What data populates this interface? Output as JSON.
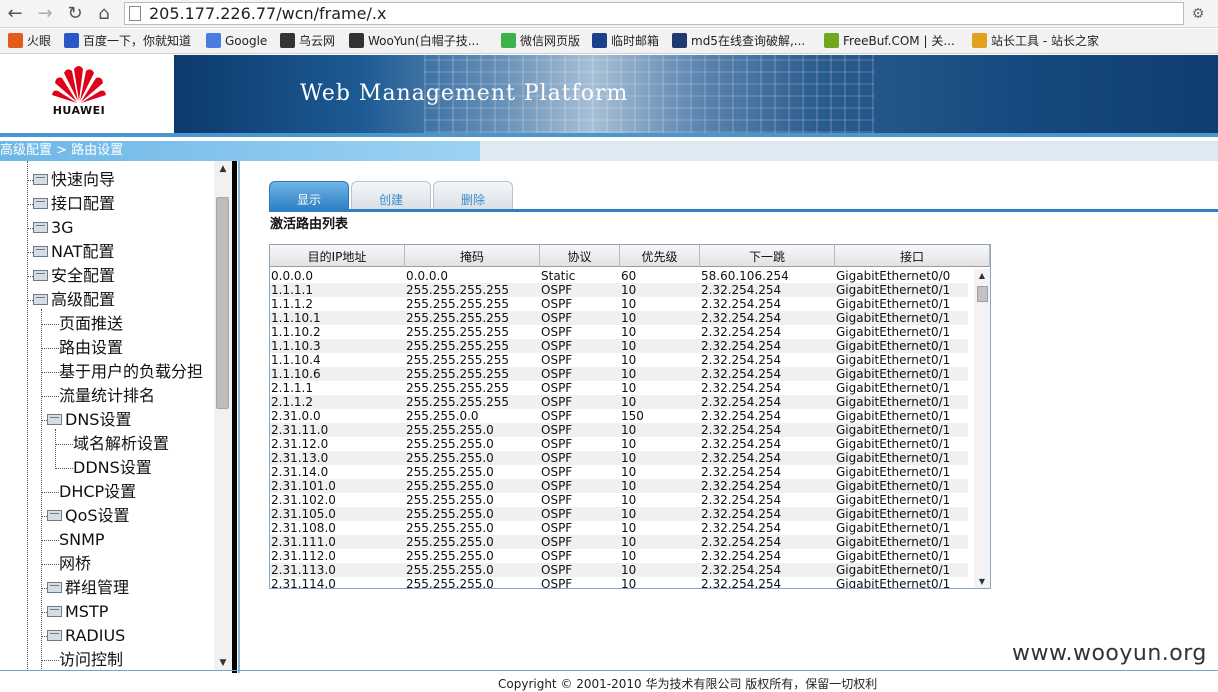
{
  "browser": {
    "url": "205.177.226.77/wcn/frame/.x",
    "back_icon": "arrow-left-icon",
    "forward_icon": "arrow-right-icon",
    "reload_icon": "reload-icon",
    "home_icon": "home-icon",
    "bookmarks": [
      {
        "label": "火眼",
        "color": "#e35b1c"
      },
      {
        "label": "百度一下，你就知道",
        "color": "#2a56c6"
      },
      {
        "label": "Google",
        "color": "#4a7be0"
      },
      {
        "label": "乌云网",
        "color": "#333333"
      },
      {
        "label": "WooYun(白帽子技...",
        "color": "#333333"
      },
      {
        "label": "微信网页版",
        "color": "#3bb24a"
      },
      {
        "label": "临时邮箱",
        "color": "#1c3f8c"
      },
      {
        "label": "md5在线查询破解,...",
        "color": "#1e3a6e"
      },
      {
        "label": "FreeBuf.COM | 关...",
        "color": "#6fa81c"
      },
      {
        "label": "站长工具 - 站长之家",
        "color": "#e0a11c"
      }
    ]
  },
  "header": {
    "logo_text": "HUAWEI",
    "title": "Web Management Platform",
    "brand_color": "#e1001a"
  },
  "breadcrumb": {
    "text": "高级配置 > 路由设置"
  },
  "sidebar": {
    "items": [
      {
        "label": "快速向导",
        "folder": true,
        "level": 0
      },
      {
        "label": "接口配置",
        "folder": true,
        "level": 0
      },
      {
        "label": "3G",
        "folder": true,
        "level": 0
      },
      {
        "label": "NAT配置",
        "folder": true,
        "level": 0
      },
      {
        "label": "安全配置",
        "folder": true,
        "level": 0
      },
      {
        "label": "高级配置",
        "folder": true,
        "level": 0
      },
      {
        "label": "页面推送",
        "folder": false,
        "level": 1
      },
      {
        "label": "路由设置",
        "folder": false,
        "level": 1
      },
      {
        "label": "基于用户的负载分担",
        "folder": false,
        "level": 1
      },
      {
        "label": "流量统计排名",
        "folder": false,
        "level": 1
      },
      {
        "label": "DNS设置",
        "folder": true,
        "level": 1
      },
      {
        "label": "域名解析设置",
        "folder": false,
        "level": 2
      },
      {
        "label": "DDNS设置",
        "folder": false,
        "level": 2
      },
      {
        "label": "DHCP设置",
        "folder": false,
        "level": 1
      },
      {
        "label": "QoS设置",
        "folder": true,
        "level": 1
      },
      {
        "label": "SNMP",
        "folder": false,
        "level": 1
      },
      {
        "label": "网桥",
        "folder": false,
        "level": 1
      },
      {
        "label": "群组管理",
        "folder": true,
        "level": 1
      },
      {
        "label": "MSTP",
        "folder": true,
        "level": 1
      },
      {
        "label": "RADIUS",
        "folder": true,
        "level": 1
      },
      {
        "label": "访问控制",
        "folder": false,
        "level": 1
      }
    ]
  },
  "tabs": [
    {
      "label": "显示",
      "active": true
    },
    {
      "label": "创建",
      "active": false
    },
    {
      "label": "删除",
      "active": false
    }
  ],
  "section_title": "激活路由列表",
  "table": {
    "columns": [
      "目的IP地址",
      "掩码",
      "协议",
      "优先级",
      "下一跳",
      "接口"
    ],
    "rows": [
      [
        "0.0.0.0",
        "0.0.0.0",
        "Static",
        "60",
        "58.60.106.254",
        "GigabitEthernet0/0"
      ],
      [
        "1.1.1.1",
        "255.255.255.255",
        "OSPF",
        "10",
        "2.32.254.254",
        "GigabitEthernet0/1"
      ],
      [
        "1.1.1.2",
        "255.255.255.255",
        "OSPF",
        "10",
        "2.32.254.254",
        "GigabitEthernet0/1"
      ],
      [
        "1.1.10.1",
        "255.255.255.255",
        "OSPF",
        "10",
        "2.32.254.254",
        "GigabitEthernet0/1"
      ],
      [
        "1.1.10.2",
        "255.255.255.255",
        "OSPF",
        "10",
        "2.32.254.254",
        "GigabitEthernet0/1"
      ],
      [
        "1.1.10.3",
        "255.255.255.255",
        "OSPF",
        "10",
        "2.32.254.254",
        "GigabitEthernet0/1"
      ],
      [
        "1.1.10.4",
        "255.255.255.255",
        "OSPF",
        "10",
        "2.32.254.254",
        "GigabitEthernet0/1"
      ],
      [
        "1.1.10.6",
        "255.255.255.255",
        "OSPF",
        "10",
        "2.32.254.254",
        "GigabitEthernet0/1"
      ],
      [
        "2.1.1.1",
        "255.255.255.255",
        "OSPF",
        "10",
        "2.32.254.254",
        "GigabitEthernet0/1"
      ],
      [
        "2.1.1.2",
        "255.255.255.255",
        "OSPF",
        "10",
        "2.32.254.254",
        "GigabitEthernet0/1"
      ],
      [
        "2.31.0.0",
        "255.255.0.0",
        "OSPF",
        "150",
        "2.32.254.254",
        "GigabitEthernet0/1"
      ],
      [
        "2.31.11.0",
        "255.255.255.0",
        "OSPF",
        "10",
        "2.32.254.254",
        "GigabitEthernet0/1"
      ],
      [
        "2.31.12.0",
        "255.255.255.0",
        "OSPF",
        "10",
        "2.32.254.254",
        "GigabitEthernet0/1"
      ],
      [
        "2.31.13.0",
        "255.255.255.0",
        "OSPF",
        "10",
        "2.32.254.254",
        "GigabitEthernet0/1"
      ],
      [
        "2.31.14.0",
        "255.255.255.0",
        "OSPF",
        "10",
        "2.32.254.254",
        "GigabitEthernet0/1"
      ],
      [
        "2.31.101.0",
        "255.255.255.0",
        "OSPF",
        "10",
        "2.32.254.254",
        "GigabitEthernet0/1"
      ],
      [
        "2.31.102.0",
        "255.255.255.0",
        "OSPF",
        "10",
        "2.32.254.254",
        "GigabitEthernet0/1"
      ],
      [
        "2.31.105.0",
        "255.255.255.0",
        "OSPF",
        "10",
        "2.32.254.254",
        "GigabitEthernet0/1"
      ],
      [
        "2.31.108.0",
        "255.255.255.0",
        "OSPF",
        "10",
        "2.32.254.254",
        "GigabitEthernet0/1"
      ],
      [
        "2.31.111.0",
        "255.255.255.0",
        "OSPF",
        "10",
        "2.32.254.254",
        "GigabitEthernet0/1"
      ],
      [
        "2.31.112.0",
        "255.255.255.0",
        "OSPF",
        "10",
        "2.32.254.254",
        "GigabitEthernet0/1"
      ],
      [
        "2.31.113.0",
        "255.255.255.0",
        "OSPF",
        "10",
        "2.32.254.254",
        "GigabitEthernet0/1"
      ],
      [
        "2.31.114.0",
        "255.255.255.0",
        "OSPF",
        "10",
        "2.32.254.254",
        "GigabitEthernet0/1"
      ]
    ]
  },
  "footer": {
    "copyright": "Copyright © 2001-2010 华为技术有限公司 版权所有，保留一切权利",
    "watermark": "www.wooyun.org"
  }
}
